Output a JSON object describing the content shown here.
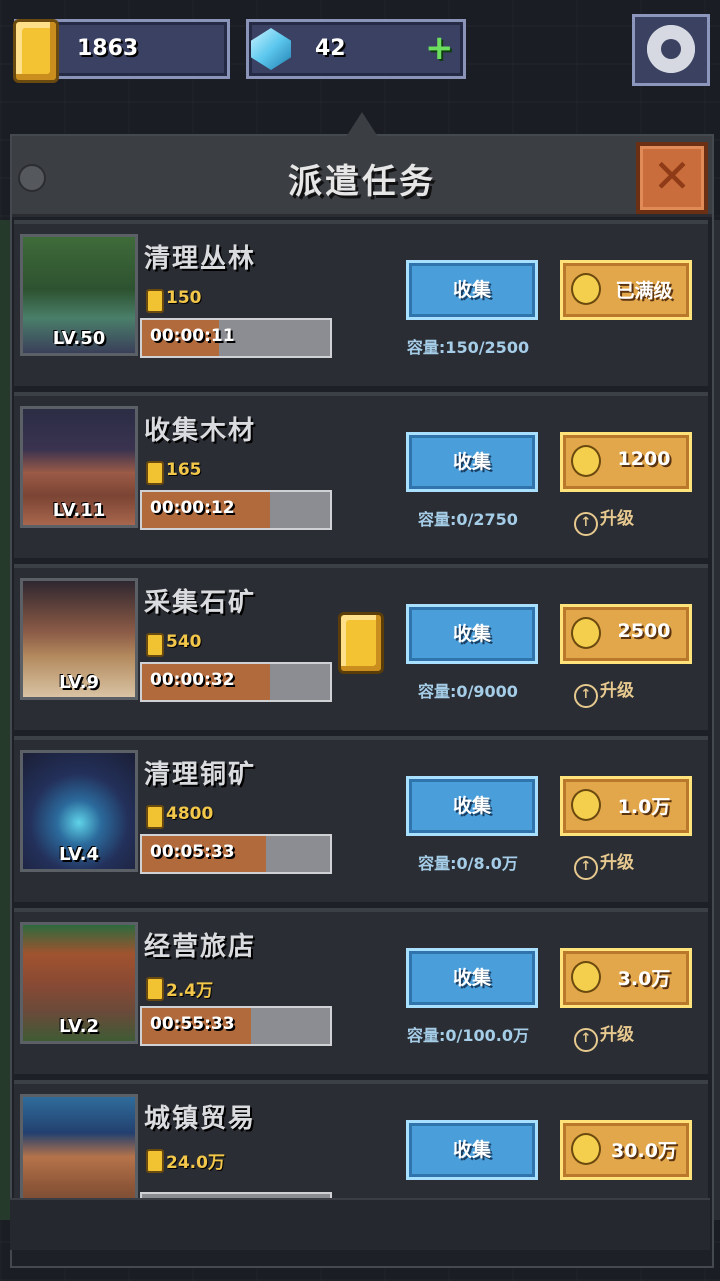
{
  "hud": {
    "coins": "1863",
    "gems": "42"
  },
  "panel": {
    "title": "派遣任务"
  },
  "tasks": [
    {
      "name": "清理丛林",
      "level": "LV.50",
      "reward": "150",
      "timer": "00:00:11",
      "progress": 0.41,
      "collect": "收集",
      "upgrade_cost": "已满级",
      "capacity": "容量:150/2500",
      "upgrade_label": ""
    },
    {
      "name": "收集木材",
      "level": "LV.11",
      "reward": "165",
      "timer": "00:00:12",
      "progress": 0.68,
      "collect": "收集",
      "upgrade_cost": "1200",
      "capacity": "容量:0/2750",
      "upgrade_label": "升级"
    },
    {
      "name": "采集石矿",
      "level": "LV.9",
      "reward": "540",
      "timer": "00:00:32",
      "progress": 0.68,
      "collect": "收集",
      "upgrade_cost": "2500",
      "capacity": "容量:0/9000",
      "upgrade_label": "升级"
    },
    {
      "name": "清理铜矿",
      "level": "LV.4",
      "reward": "4800",
      "timer": "00:05:33",
      "progress": 0.66,
      "collect": "收集",
      "upgrade_cost": "1.0万",
      "capacity": "容量:0/8.0万",
      "upgrade_label": "升级"
    },
    {
      "name": "经营旅店",
      "level": "LV.2",
      "reward": "2.4万",
      "timer": "00:55:33",
      "progress": 0.58,
      "collect": "收集",
      "upgrade_cost": "3.0万",
      "capacity": "容量:0/100.0万",
      "upgrade_label": "升级"
    },
    {
      "name": "城镇贸易",
      "level": "",
      "reward": "24.0万",
      "timer": "",
      "progress": 0.0,
      "collect": "收集",
      "upgrade_cost": "30.0万",
      "capacity": "",
      "upgrade_label": ""
    }
  ],
  "colors": {
    "collect": "#4a9fdb",
    "upgrade": "#e3a74b",
    "progress_fill": "#b06a3c"
  },
  "icons": {
    "coin": "gold-coin-icon",
    "gem": "blue-gem-icon",
    "plus": "plus-icon",
    "settings": "gear-icon",
    "close": "close-icon",
    "upgrade": "arrow-up-circle-icon"
  }
}
